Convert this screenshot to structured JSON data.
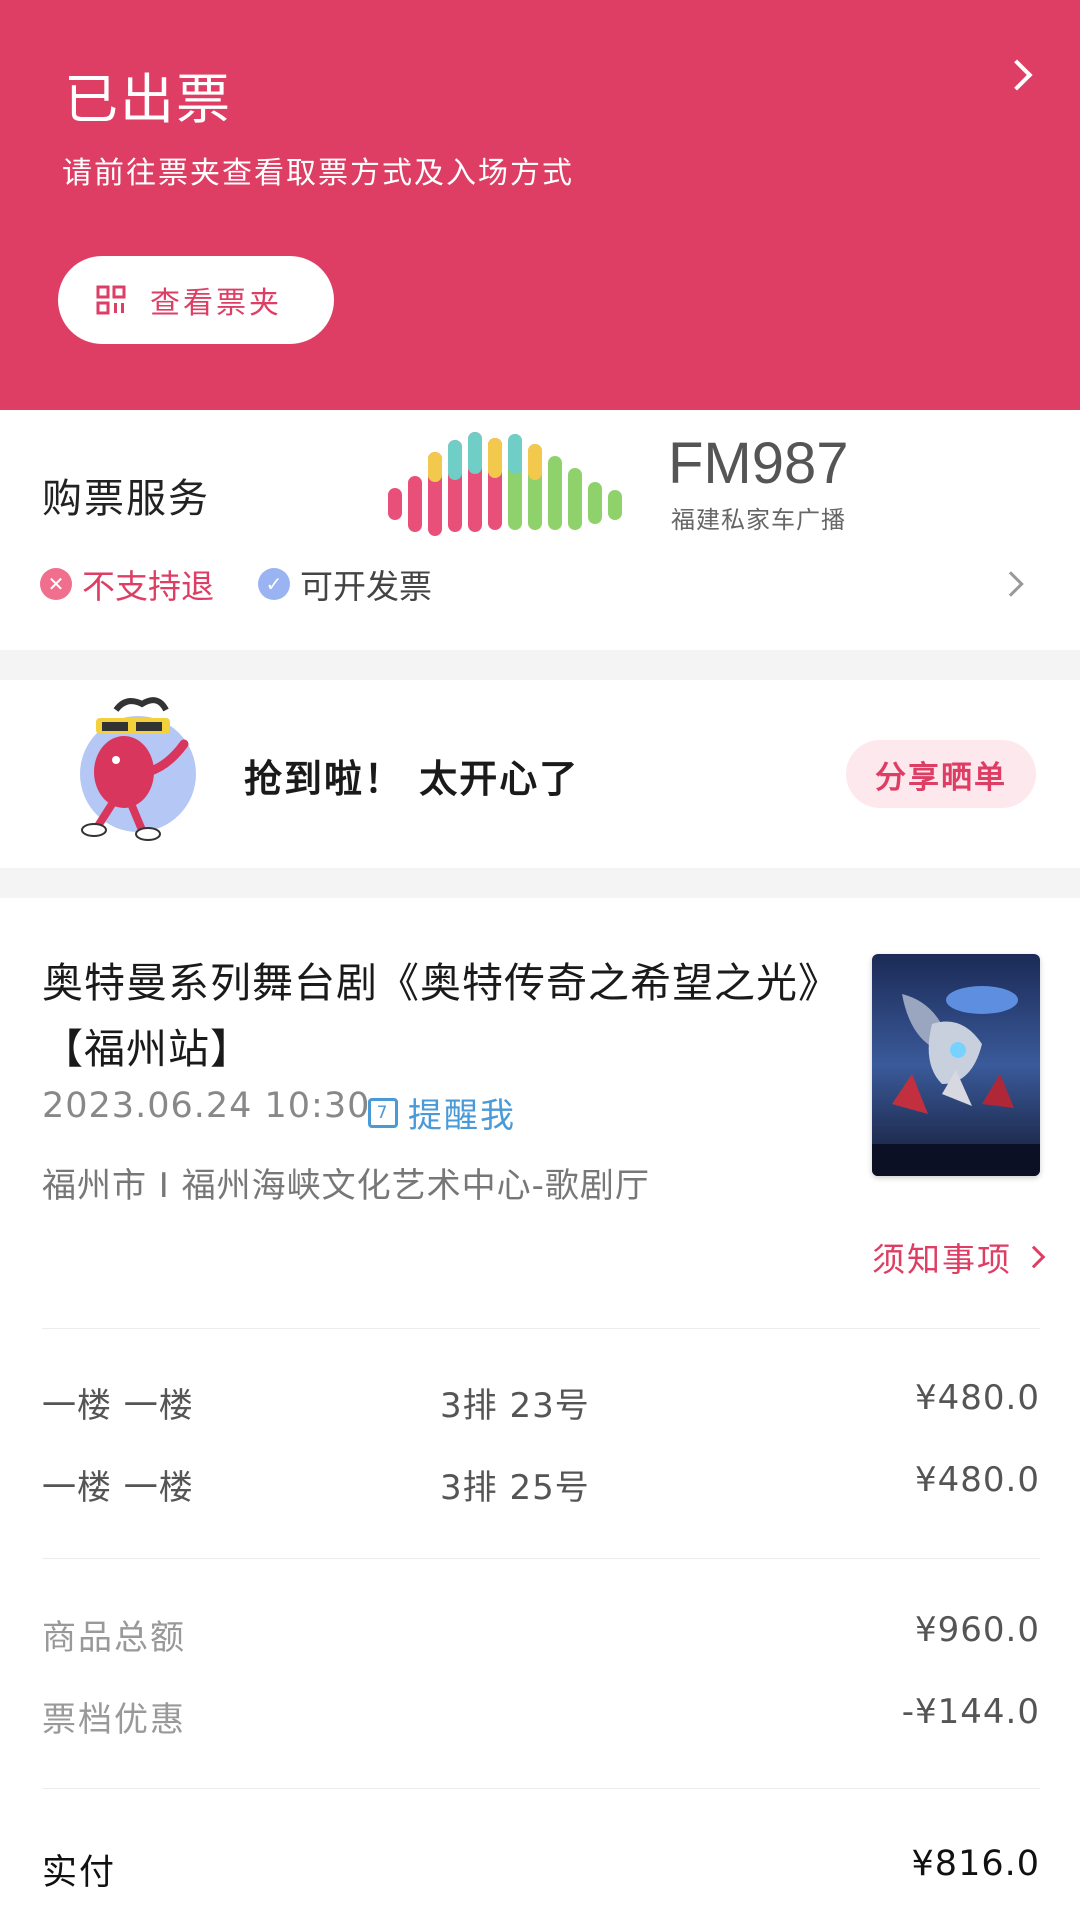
{
  "header": {
    "title": "已出票",
    "subtitle": "请前往票夹查看取票方式及入场方式",
    "ticket_button": "查看票夹"
  },
  "service": {
    "title": "购票服务",
    "tag_refund": "不支持退",
    "tag_invoice": "可开发票",
    "logo_text": "FM987",
    "logo_sub": "福建私家车广播"
  },
  "share": {
    "text": "抢到啦！ 太开心了",
    "button": "分享晒单"
  },
  "show": {
    "name": "奥特曼系列舞台剧《奥特传奇之希望之光》【福州站】",
    "datetime": "2023.06.24 10:30",
    "remind": "提醒我",
    "venue": "福州市 I 福州海峡文化艺术中心-歌剧厅",
    "notice": "须知事项"
  },
  "tickets": [
    {
      "area": "一楼 一楼",
      "seat": "3排 23号",
      "price": "¥480.0"
    },
    {
      "area": "一楼 一楼",
      "seat": "3排 25号",
      "price": "¥480.0"
    }
  ],
  "summary": {
    "subtotal_label": "商品总额",
    "subtotal_value": "¥960.0",
    "discount_label": "票档优惠",
    "discount_value": "-¥144.0",
    "paid_label": "实付",
    "paid_value": "¥816.0"
  },
  "colors": {
    "brand": "#de3e64",
    "link": "#4a9ad8"
  },
  "icons": {
    "ticket_button_icon": "qr-grid-icon",
    "header_chevron": "chevron-right-icon",
    "refund_tag_icon": "x-circle-icon",
    "invoice_tag_icon": "check-circle-icon",
    "remind_icon": "calendar-icon"
  }
}
